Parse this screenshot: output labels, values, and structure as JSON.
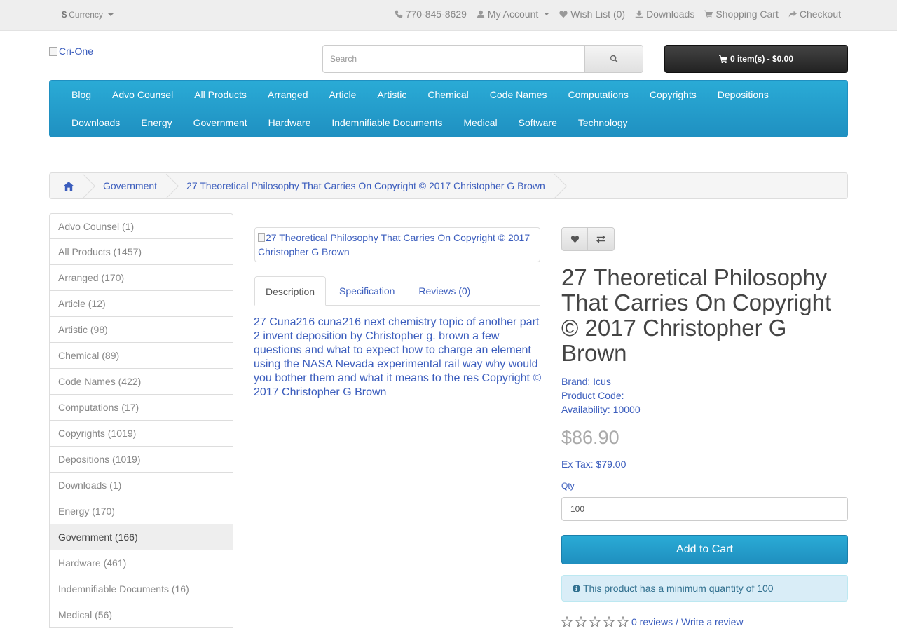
{
  "topbar": {
    "currency_symbol": "$",
    "currency_label": "Currency",
    "phone": "770-845-8629",
    "my_account": "My Account",
    "wish_list": "Wish List (0)",
    "downloads": "Downloads",
    "shopping_cart": "Shopping Cart",
    "checkout": "Checkout"
  },
  "header": {
    "logo_alt": "Cri-One",
    "search_placeholder": "Search",
    "cart_summary": "0 item(s) - $0.00"
  },
  "menu": {
    "row1": [
      "Blog",
      "Advo Counsel",
      "All Products",
      "Arranged",
      "Article",
      "Artistic",
      "Chemical",
      "Code Names",
      "Computations",
      "Copyrights",
      "Depositions"
    ],
    "row2": [
      "Downloads",
      "Energy",
      "Government",
      "Hardware",
      "Indemnifiable Documents",
      "Medical",
      "Software",
      "Technology"
    ]
  },
  "breadcrumb": {
    "home_icon": "home-icon",
    "items": [
      "Government",
      "27 Theoretical Philosophy That Carries On Copyright © 2017 Christopher G Brown"
    ]
  },
  "sidebar": {
    "items": [
      "Advo Counsel (1)",
      "All Products (1457)",
      "Arranged (170)",
      "Article (12)",
      "Artistic (98)",
      "Chemical (89)",
      "Code Names (422)",
      "Computations (17)",
      "Copyrights (1019)",
      "Depositions (1019)",
      "Downloads (1)",
      "Energy (170)",
      "Government (166)",
      "Hardware (461)",
      "Indemnifiable Documents (16)",
      "Medical (56)"
    ],
    "active_index": 12
  },
  "product": {
    "image_alt": "27 Theoretical Philosophy That Carries On Copyright © 2017 Christopher G Brown",
    "tabs": [
      "Description",
      "Specification",
      "Reviews (0)"
    ],
    "description": "27 Cuna216 cuna216 next chemistry topic of another part 2 invent deposition by Christopher g. brown a few questions and what to expect how to charge an element using the NASA Nevada experimental rail way why would you bother them and what it means to the res Copyright © 2017 Christopher G Brown",
    "title": "27 Theoretical Philosophy That Carries On Copyright © 2017 Christopher G Brown",
    "brand_label": "Brand:",
    "brand": "Icus",
    "product_code_label": "Product Code:",
    "availability_label": "Availability:",
    "availability": "10000",
    "price": "$86.90",
    "ex_tax": "Ex Tax: $79.00",
    "qty_label": "Qty",
    "qty_value": "100",
    "add_to_cart": "Add to Cart",
    "min_qty_notice": "This product has a minimum quantity of 100",
    "reviews_link": "0 reviews",
    "review_sep": "/",
    "write_review": "Write a review",
    "rating": 0,
    "rating_max": 5
  },
  "colors": {
    "accent": "#229ac8",
    "link": "#3b5dbd",
    "info_bg": "#d9edf7"
  }
}
